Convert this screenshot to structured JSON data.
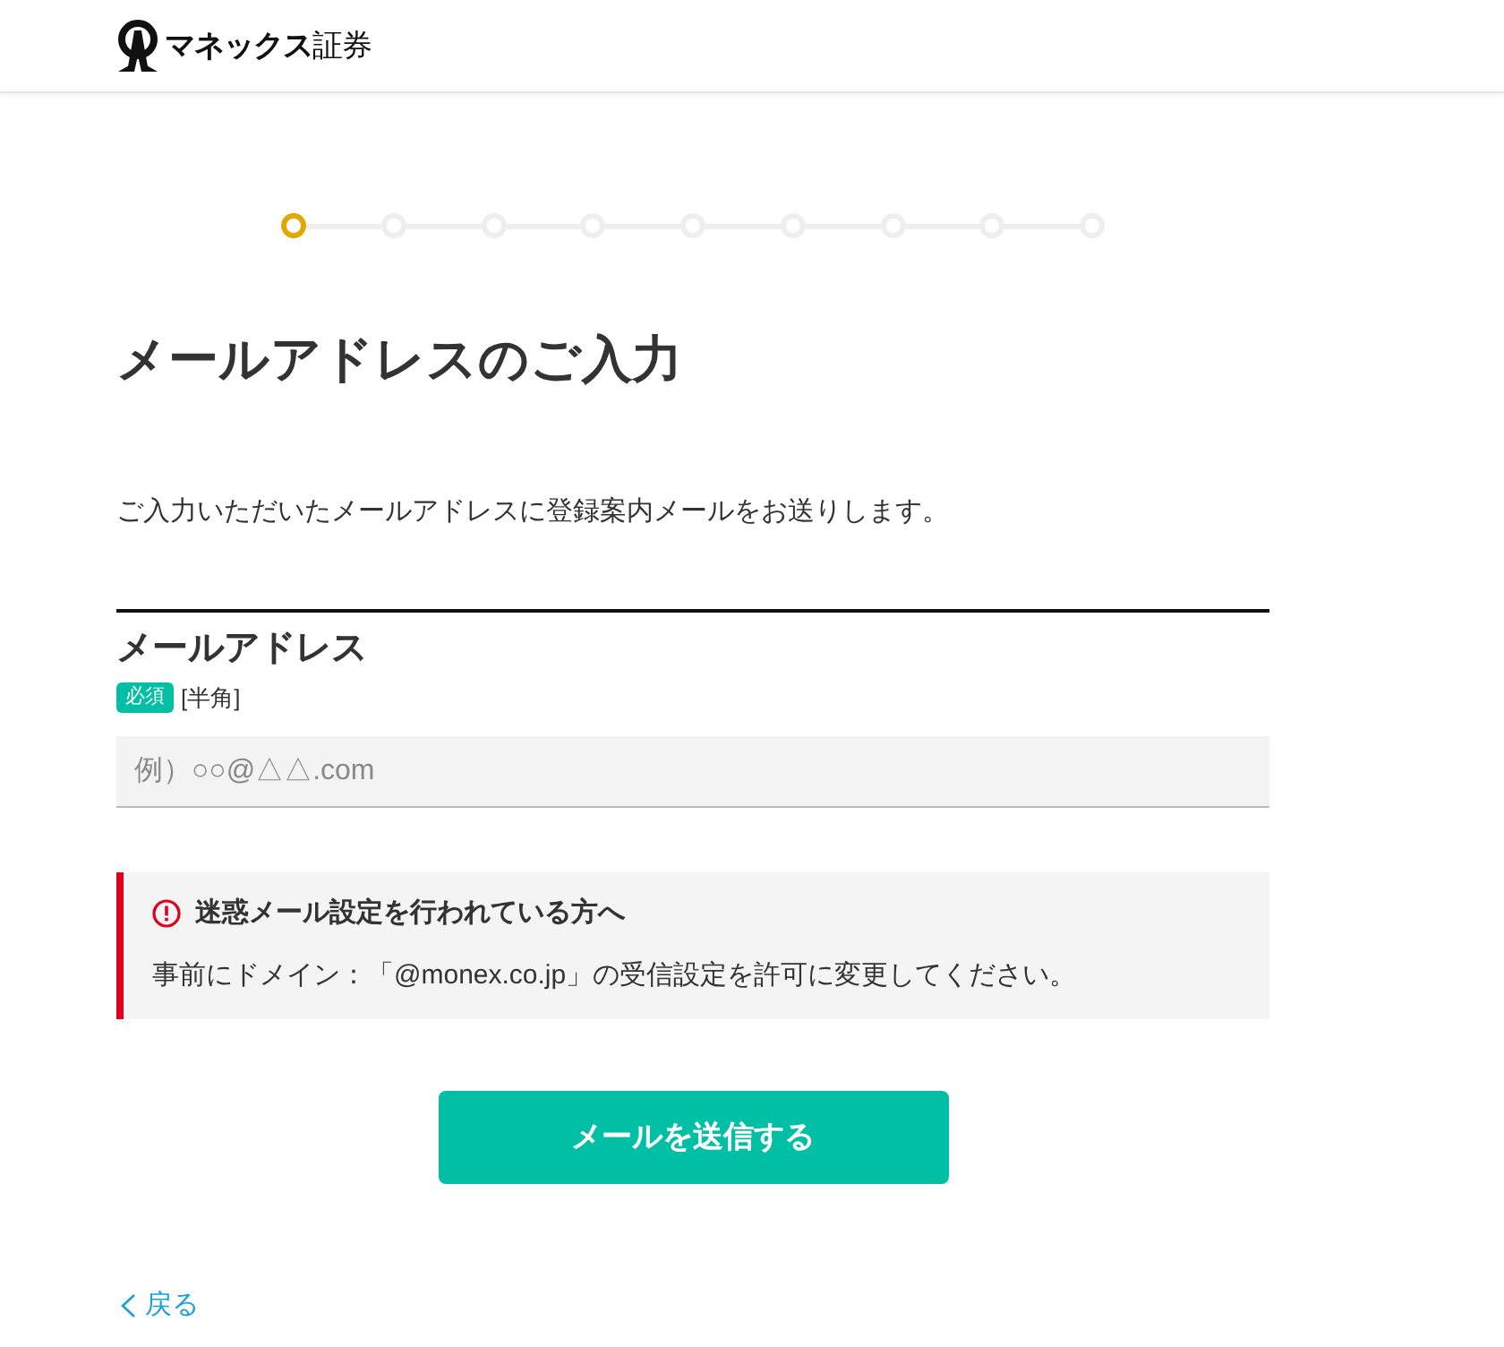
{
  "header": {
    "logo_text": "**マネックス**証券"
  },
  "stepper": {
    "steps": [
      {
        "selected": true
      },
      {
        "selected": false
      },
      {
        "selected": false
      },
      {
        "selected": false
      },
      {
        "selected": false
      },
      {
        "selected": false
      },
      {
        "selected": false
      },
      {
        "selected": false
      },
      {
        "selected": false
      }
    ]
  },
  "page_title": "メールアドレスのご入力",
  "description": "ご入力いただいたメールアドレスに登録案内メールをお送りします。",
  "email_field": {
    "label": "メールアドレス",
    "required_badge": "必須",
    "format_note": "[半角]",
    "placeholder": "例）○○@△△.com"
  },
  "notice": {
    "title": "迷惑メール設定を行われている方へ",
    "body": "事前にドメイン：「@monex.co.jp」の受信設定を許可に変更してください。"
  },
  "submit_button": "メールを送信する",
  "back_link": "戻る"
}
